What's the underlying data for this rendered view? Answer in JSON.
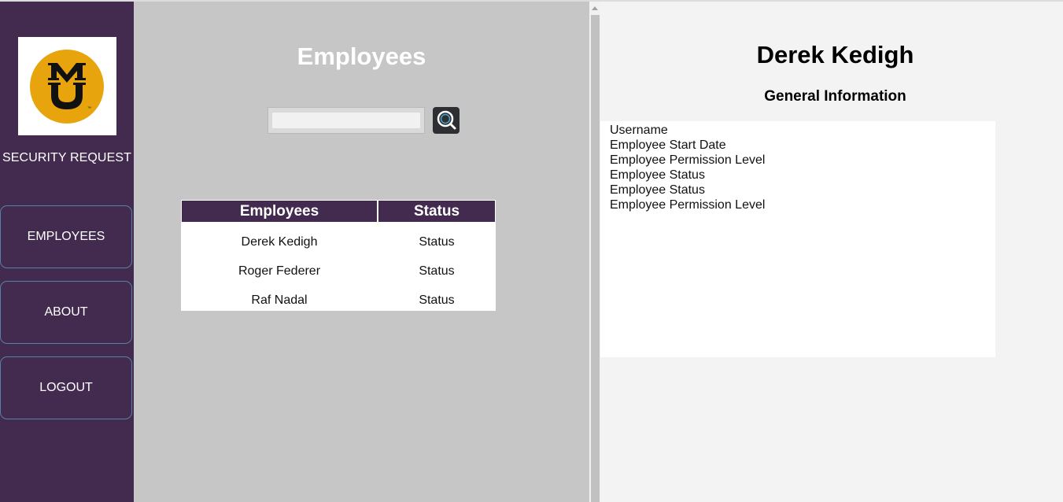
{
  "sidebar": {
    "logo_text": "MU",
    "app_title": "SECURITY REQUEST",
    "nav": [
      {
        "label": "EMPLOYEES"
      },
      {
        "label": "ABOUT"
      },
      {
        "label": "LOGOUT"
      }
    ]
  },
  "main": {
    "title": "Employees",
    "search": {
      "value": "",
      "placeholder": ""
    },
    "table": {
      "headers": [
        "Employees",
        "Status"
      ],
      "rows": [
        {
          "name": "Derek Kedigh",
          "status": "Status"
        },
        {
          "name": "Roger Federer",
          "status": "Status"
        },
        {
          "name": "Raf Nadal",
          "status": "Status"
        }
      ]
    }
  },
  "detail": {
    "name": "Derek Kedigh",
    "section_title": "General Information",
    "fields": [
      "Username",
      "Employee Start Date",
      "Employee Permission Level",
      "Employee Status",
      "Employee Status",
      "Employee Permission Level"
    ]
  },
  "colors": {
    "brand_purple": "#432b50",
    "gold": "#e8a40c",
    "panel_gray": "#c6c6c6"
  }
}
